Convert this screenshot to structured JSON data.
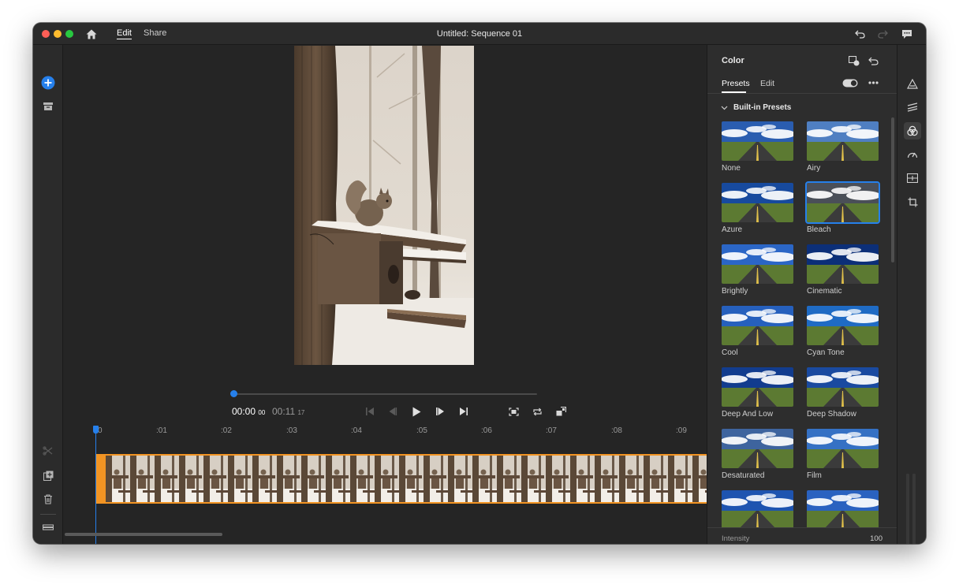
{
  "window": {
    "title": "Untitled: Sequence 01"
  },
  "titlebar": {
    "nav": [
      {
        "label": "Edit",
        "active": true
      },
      {
        "label": "Share",
        "active": false
      }
    ]
  },
  "player": {
    "current_time": "00:00",
    "current_frames": "00",
    "duration": "00:11",
    "duration_frames": "17",
    "progress": 0.0
  },
  "ruler": {
    "labels": [
      "0",
      ":01",
      ":02",
      ":03",
      ":04",
      ":05",
      ":06",
      ":07",
      ":08",
      ":09"
    ]
  },
  "panel": {
    "title": "Color",
    "tabs": [
      {
        "label": "Presets",
        "active": true
      },
      {
        "label": "Edit",
        "active": false
      }
    ],
    "section": "Built-in Presets",
    "presets": [
      {
        "label": "None"
      },
      {
        "label": "Airy"
      },
      {
        "label": "Azure"
      },
      {
        "label": "Bleach",
        "selected": true
      },
      {
        "label": "Brightly"
      },
      {
        "label": "Cinematic"
      },
      {
        "label": "Cool"
      },
      {
        "label": "Cyan Tone"
      },
      {
        "label": "Deep And Low"
      },
      {
        "label": "Deep Shadow"
      },
      {
        "label": "Desaturated"
      },
      {
        "label": "Film"
      },
      {
        "label": ""
      },
      {
        "label": ""
      }
    ],
    "intensity": {
      "label": "Intensity",
      "value": "100",
      "fraction": 0.5
    }
  },
  "colors": {
    "accent": "#2680eb",
    "clip": "#f29423",
    "background": "#252525",
    "panel": "#2d2d2d"
  },
  "icons": {
    "titlebar": [
      "home-icon",
      "undo-icon",
      "redo-icon",
      "feedback-icon"
    ],
    "left_rail": [
      "add-media-icon",
      "project-archive-icon",
      "split-icon",
      "duplicate-icon",
      "delete-icon",
      "track-icon",
      "timeline-list-icon"
    ],
    "player": [
      "go-to-start-icon",
      "step-back-icon",
      "play-icon",
      "step-forward-icon",
      "go-to-end-icon",
      "fit-frame-icon",
      "loop-icon",
      "fullscreen-icon",
      "menu-icon"
    ],
    "panel": [
      "compare-icon",
      "reset-icon",
      "toggle-icon",
      "more-icon",
      "chevron-down-icon"
    ],
    "right_rail": [
      "titles-icon",
      "audio-icon",
      "color-icon",
      "speed-icon",
      "transform-icon",
      "crop-icon"
    ]
  }
}
